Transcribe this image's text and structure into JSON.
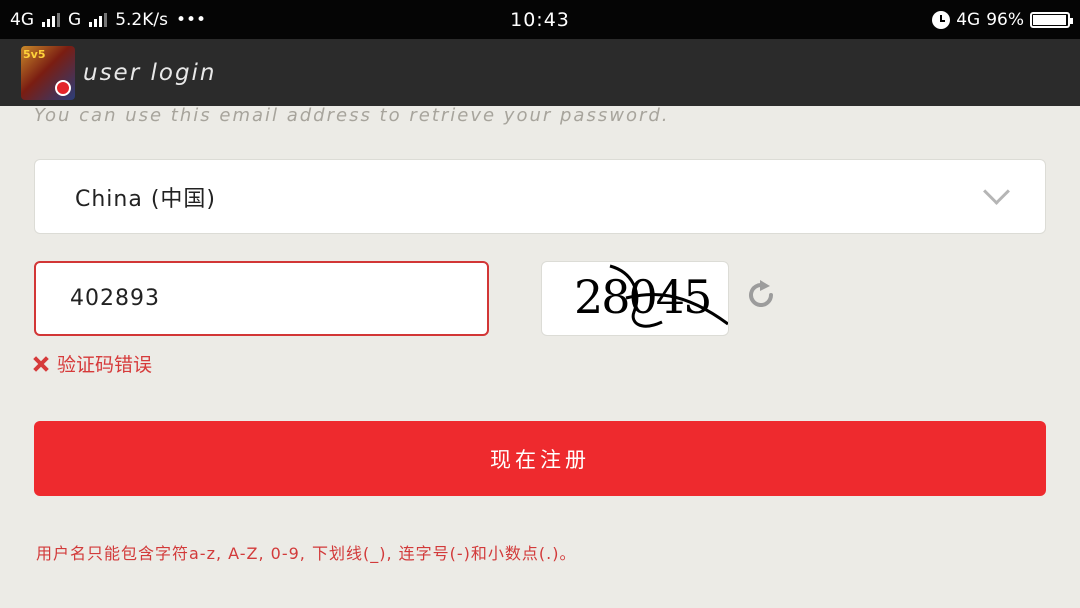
{
  "status_bar": {
    "net1": "4G",
    "net2": "G",
    "speed": "5.2K/s",
    "more": "•••",
    "time": "10:43",
    "net3": "4G",
    "battery_percent_text": "96%",
    "battery_level": 0.96
  },
  "app_bar": {
    "icon_badge": "5v5",
    "title": "user login"
  },
  "form": {
    "hint": "You can use this email address to retrieve your password.",
    "country_value": "China (中国)",
    "captcha_value": "402893",
    "captcha_image_text": "28045",
    "error_text": "验证码错误",
    "submit_label": "现在注册",
    "rules_text": "用户名只能包含字符a-z, A-Z, 0-9, 下划线(_), 连字号(-)和小数点(.)。"
  },
  "colors": {
    "accent": "#ee2a2e",
    "error": "#d63a3a",
    "appbar": "#2b2b2b",
    "background": "#ecebe6"
  }
}
